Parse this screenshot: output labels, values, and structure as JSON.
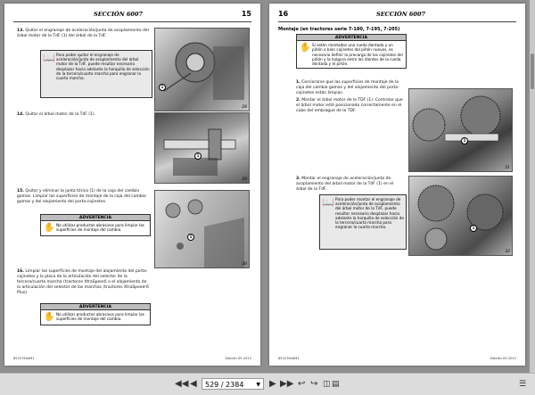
{
  "left_page": {
    "section": "SECCIÓN 6007",
    "page_number": "15",
    "footer_left": "85227644M1",
    "footer_right": "Edición 05-2012",
    "steps": [
      {
        "num": "13.",
        "text": "Quitar el engranaje de aceleración/junta de acoplamiento del árbol motor de la TdF (1) del árbol de la TdF."
      },
      {
        "num": "14.",
        "text": "Quitar el árbol motor de la TdF (1)."
      },
      {
        "num": "15.",
        "text": "Quitar y eliminar la junta tórica (1) de la caja del cambio gamas. Limpiar las superficies de montaje de la caja del cambio gamas y del alojamiento del porta-cojinetes."
      },
      {
        "num": "16.",
        "text": "Limpiar las superficies de montaje del alojamiento del porta-cojinetes y la placa de la articulación del selector de la tercera/cuarta marcha (tractores XtraSpeed) o el alojamiento de la articulación del selector de las marchas (tractores XtraSpeed-6 Plus)."
      }
    ],
    "note1": "Para poder quitar el engranaje de aceleración/junta de acoplamiento del árbol motor de la TdF, puede resultar necesario desplazar hacia adelante la horquilla de selección de la tercera/cuarta marcha para engranar la cuarta marcha.",
    "warning_title": "ADVERTENCIA",
    "warning1": "No utilizar productos abrasivos para limpiar las superficies de montaje del cambio.",
    "warning2": "No utilizar productos abrasivos para limpiar las superficies de montaje del cambio.",
    "fig_28": "28",
    "fig_29": "29",
    "fig_30": "30",
    "callout": "1"
  },
  "right_page": {
    "section": "SECCIÓN 6007",
    "page_number": "16",
    "footer_left": "85227644M1",
    "footer_right": "Edición 05-2012",
    "heading": "Montaje (en tractores serie 7-180, 7-195, 7-205)",
    "warning_title": "ADVERTENCIA",
    "warning_top": "Si están montados una rueda dentada y un piñón o bien cojinetes del piñón nuevos, es necesario definir la precarga de los cojinetes del piñón y la holgura entre los dientes de la rueda dentada y el piñón.",
    "steps": [
      {
        "num": "1.",
        "text": "Cerciorarse que las superficies de montaje de la caja del cambio gamas y del alojamiento del porta-cojinetes están limpias."
      },
      {
        "num": "2.",
        "text": "Montar el árbol motor de la TDF (1). Controlar que el árbol motor esté posicionado correctamente en el cubo del embrague de la TDF."
      },
      {
        "num": "3.",
        "text": "Montar el engranaje de aceleración/junta de acoplamiento del árbol motor de la TdF (1) en el árbol de la TdF."
      }
    ],
    "note": "Para poder montar el engranaje de aceleración/junta de acoplamiento del árbol motor de la TdF, puede resultar necesario desplazar hacia adelante la horquilla de selección de la tercera/cuarta marcha para engranar la cuarta marcha.",
    "fig_31": "31",
    "fig_32": "32",
    "callout": "1"
  },
  "toolbar": {
    "page_field": "529 / 2384",
    "icons": [
      "first-page-icon",
      "prev-page-icon",
      "next-page-icon",
      "last-page-icon",
      "back-icon",
      "forward-icon",
      "two-page-icon",
      "continuous-icon",
      "menu-icon"
    ]
  }
}
